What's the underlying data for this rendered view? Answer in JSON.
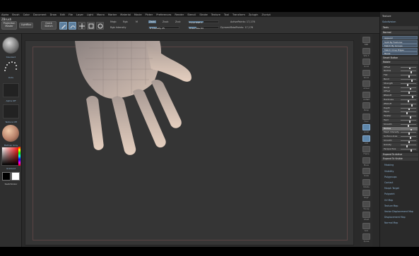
{
  "app": {
    "brand": "ZBrush",
    "menu": [
      "Alpha",
      "Brush",
      "Color",
      "Document",
      "Draw",
      "Edit",
      "File",
      "Layer",
      "Light",
      "Macro",
      "Marker",
      "Material",
      "Movie",
      "Picker",
      "Preferences",
      "Render",
      "Stencil",
      "Stroke",
      "Texture",
      "Tool",
      "Transform",
      "Zplugin",
      "Zscript"
    ]
  },
  "shelf": {
    "projection_master": "Projection Master",
    "lightbox": "LightBox",
    "quick_sketch": "Quick Sketch",
    "modes": [
      {
        "name": "edit",
        "icon": "edit-icon",
        "active": true
      },
      {
        "name": "draw",
        "icon": "draw-icon",
        "active": true
      },
      {
        "name": "move",
        "icon": "move-icon",
        "active": false
      },
      {
        "name": "scale",
        "icon": "scale-icon",
        "active": false
      },
      {
        "name": "rotate",
        "icon": "rotate-icon",
        "active": false
      }
    ],
    "mrgb": "Mrgb",
    "rgb": "Rgb",
    "m": "M",
    "zadd": "Zadd",
    "zsub": "Zsub",
    "zcut": "Zcut",
    "rgb_intensity": "Rgb Intensity",
    "rgb_intensity_value": "25",
    "z_intensity": "Z Intensity",
    "z_intensity_value": "25",
    "focal_shift": "Focal Shift",
    "focal_shift_value": "0",
    "draw_size": "Draw Size",
    "draw_size_value": "64",
    "dynamic": "Dynamic",
    "active_points": "ActivePoints:",
    "active_points_value": "17,176",
    "total_points": "TotalPoints:",
    "total_points_value": "17,176"
  },
  "left_tray": {
    "brush_label": "Standard",
    "stroke_label": "Dots",
    "alpha_label": "Alpha Off",
    "texture_label": "Texture Off",
    "material_label": "MatCap Gray",
    "gradient_label": "Gradient",
    "switch_color_label": "SwitchColor",
    "colors": {
      "primary": "#000000",
      "secondary": "#ffffff"
    }
  },
  "icon_strip": {
    "buttons": [
      {
        "name": "bpr",
        "label": "BPR",
        "active": false
      },
      {
        "name": "spix",
        "label": "SPix 3",
        "active": false
      },
      {
        "name": "scroll",
        "label": "Scroll",
        "active": false
      },
      {
        "name": "zoom",
        "label": "Zoom",
        "active": false
      },
      {
        "name": "actual",
        "label": "Actual",
        "active": false
      },
      {
        "name": "aahalf",
        "label": "AAHalf",
        "active": false
      },
      {
        "name": "persp",
        "label": "Persp",
        "active": false
      },
      {
        "name": "floor",
        "label": "Floor",
        "active": false
      },
      {
        "name": "local",
        "label": "Local",
        "active": true
      },
      {
        "name": "xyz",
        "label": "XYZ",
        "active": true
      },
      {
        "name": "frame",
        "label": "Frame",
        "active": false
      },
      {
        "name": "move",
        "label": "Move",
        "active": false
      },
      {
        "name": "scale",
        "label": "Scale",
        "active": false
      },
      {
        "name": "rotate",
        "label": "Rotate",
        "active": false
      },
      {
        "name": "polyf",
        "label": "PolyF",
        "active": false
      },
      {
        "name": "transp",
        "label": "Transp",
        "active": false
      },
      {
        "name": "ghost",
        "label": "Ghost",
        "active": false
      },
      {
        "name": "solo",
        "label": "Solo",
        "active": false
      },
      {
        "name": "xpose",
        "label": "Xpose",
        "active": false
      }
    ]
  },
  "right_panel": {
    "title": "Texture",
    "sub_title": "Subdivision",
    "header1": "Tools",
    "header2": "Normal",
    "buttons": [
      "Append",
      "Split By Features",
      "Match By Groups",
      "Match Crisp Edges",
      "Bevel"
    ],
    "header3": "Smart Button",
    "header4": "Rotate",
    "rows": [
      {
        "label": "Offset",
        "value": 0.55,
        "selected": false
      },
      {
        "label": "Radius",
        "value": 0.62,
        "selected": false
      },
      {
        "label": "Flat",
        "value": 0.48,
        "selected": false
      },
      {
        "label": "Bend",
        "value": 0.7,
        "selected": false
      },
      {
        "label": "Strength",
        "value": 0.4,
        "selected": false
      },
      {
        "label": "Bevel",
        "value": 0.58,
        "selected": false
      },
      {
        "label": "Offset",
        "value": 0.5,
        "selected": false
      },
      {
        "label": "BFalloff",
        "value": 0.72,
        "selected": false
      },
      {
        "label": "Hardness",
        "value": 0.45,
        "selected": false
      },
      {
        "label": "ZFalloff",
        "value": 0.66,
        "selected": false
      },
      {
        "label": "Depth",
        "value": 0.52,
        "selected": false
      },
      {
        "label": "Taper",
        "value": 0.38,
        "selected": false
      },
      {
        "label": "Twister",
        "value": 0.6,
        "selected": false
      },
      {
        "label": "Twirl",
        "value": 0.54,
        "selected": false
      },
      {
        "label": "Smooth",
        "value": 0.44,
        "selected": false
      },
      {
        "label": "Radius",
        "value": 0.62,
        "selected": true
      },
      {
        "label": "Mesh Intensity",
        "value": 0.5,
        "selected": false
      },
      {
        "label": "Surface Area",
        "value": 0.57,
        "selected": false
      },
      {
        "label": "Smooth",
        "value": 0.49,
        "selected": false
      },
      {
        "label": "Gravity",
        "value": 0.35,
        "selected": false
      },
      {
        "label": "Perspective",
        "value": 0.63,
        "selected": false
      }
    ],
    "header5": "Expand To Active",
    "header6": "Expand To Visible",
    "bottom_items": [
      "Masking",
      "Visibility",
      "Polygroups",
      "Contact",
      "Morph Target",
      "Polypaint",
      "UV Map",
      "Texture Map",
      "Vector Displacement Map",
      "Displacement Map",
      "Normal Map"
    ]
  }
}
